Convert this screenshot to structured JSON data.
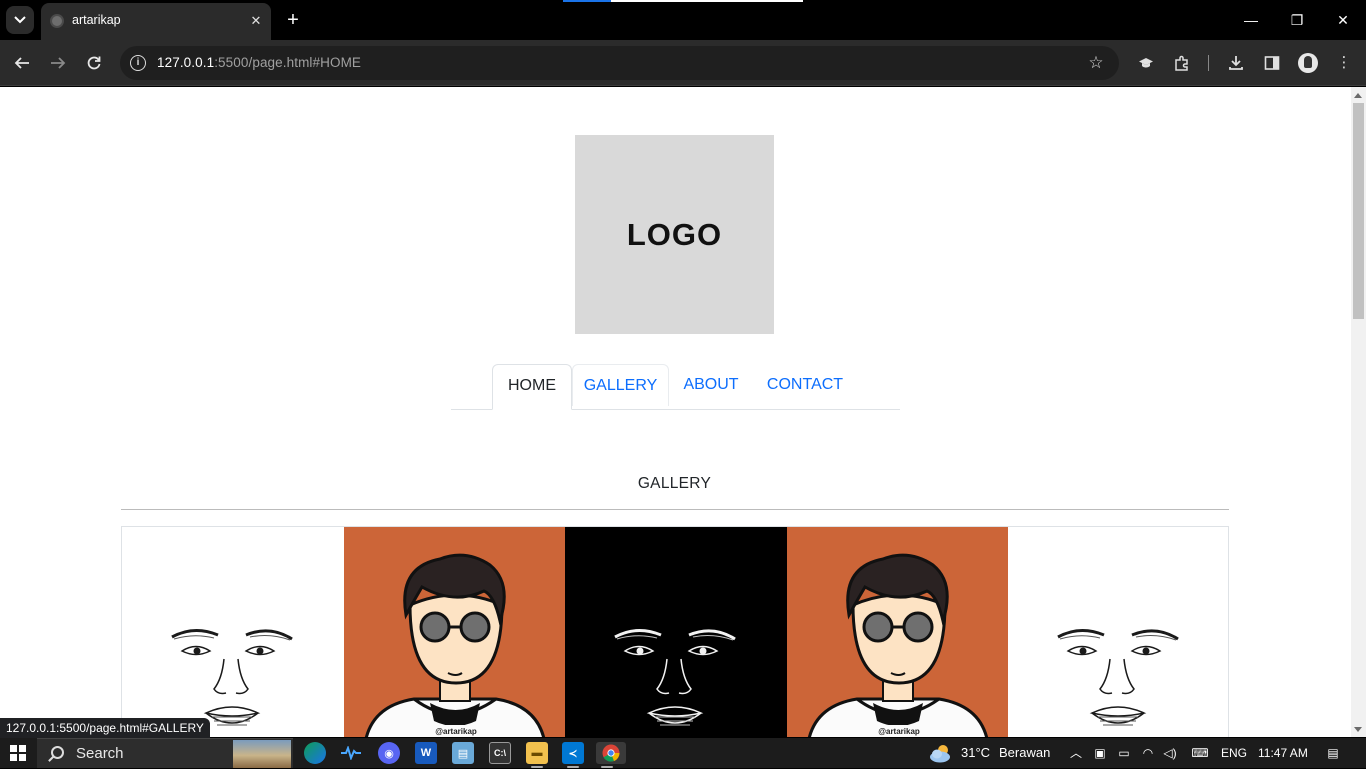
{
  "browser": {
    "tab_title": "artarikap",
    "url_host": "127.0.0.1",
    "url_rest": ":5500/page.html#HOME",
    "status_url": "127.0.0.1:5500/page.html#GALLERY"
  },
  "page": {
    "logo_text": "LOGO",
    "nav": [
      {
        "label": "HOME"
      },
      {
        "label": "GALLERY"
      },
      {
        "label": "ABOUT"
      },
      {
        "label": "CONTACT"
      }
    ],
    "section_heading": "GALLERY",
    "gallery": [
      {
        "style": "sketch-light",
        "bg": "#ffffff"
      },
      {
        "style": "portrait",
        "bg": "#cc6538",
        "watermark": "@artarikap"
      },
      {
        "style": "sketch-dark",
        "bg": "#000000"
      },
      {
        "style": "portrait",
        "bg": "#cc6538",
        "watermark": "@artarikap"
      },
      {
        "style": "sketch-light",
        "bg": "#ffffff"
      }
    ]
  },
  "taskbar": {
    "search_label": "Search",
    "temperature": "31°C",
    "weather_desc": "Berawan",
    "language": "ENG",
    "time": "11:47 AM"
  },
  "colors": {
    "accent": "#0d6efd",
    "portrait_bg": "#cc6538",
    "logo_bg": "#d9d9d9"
  }
}
